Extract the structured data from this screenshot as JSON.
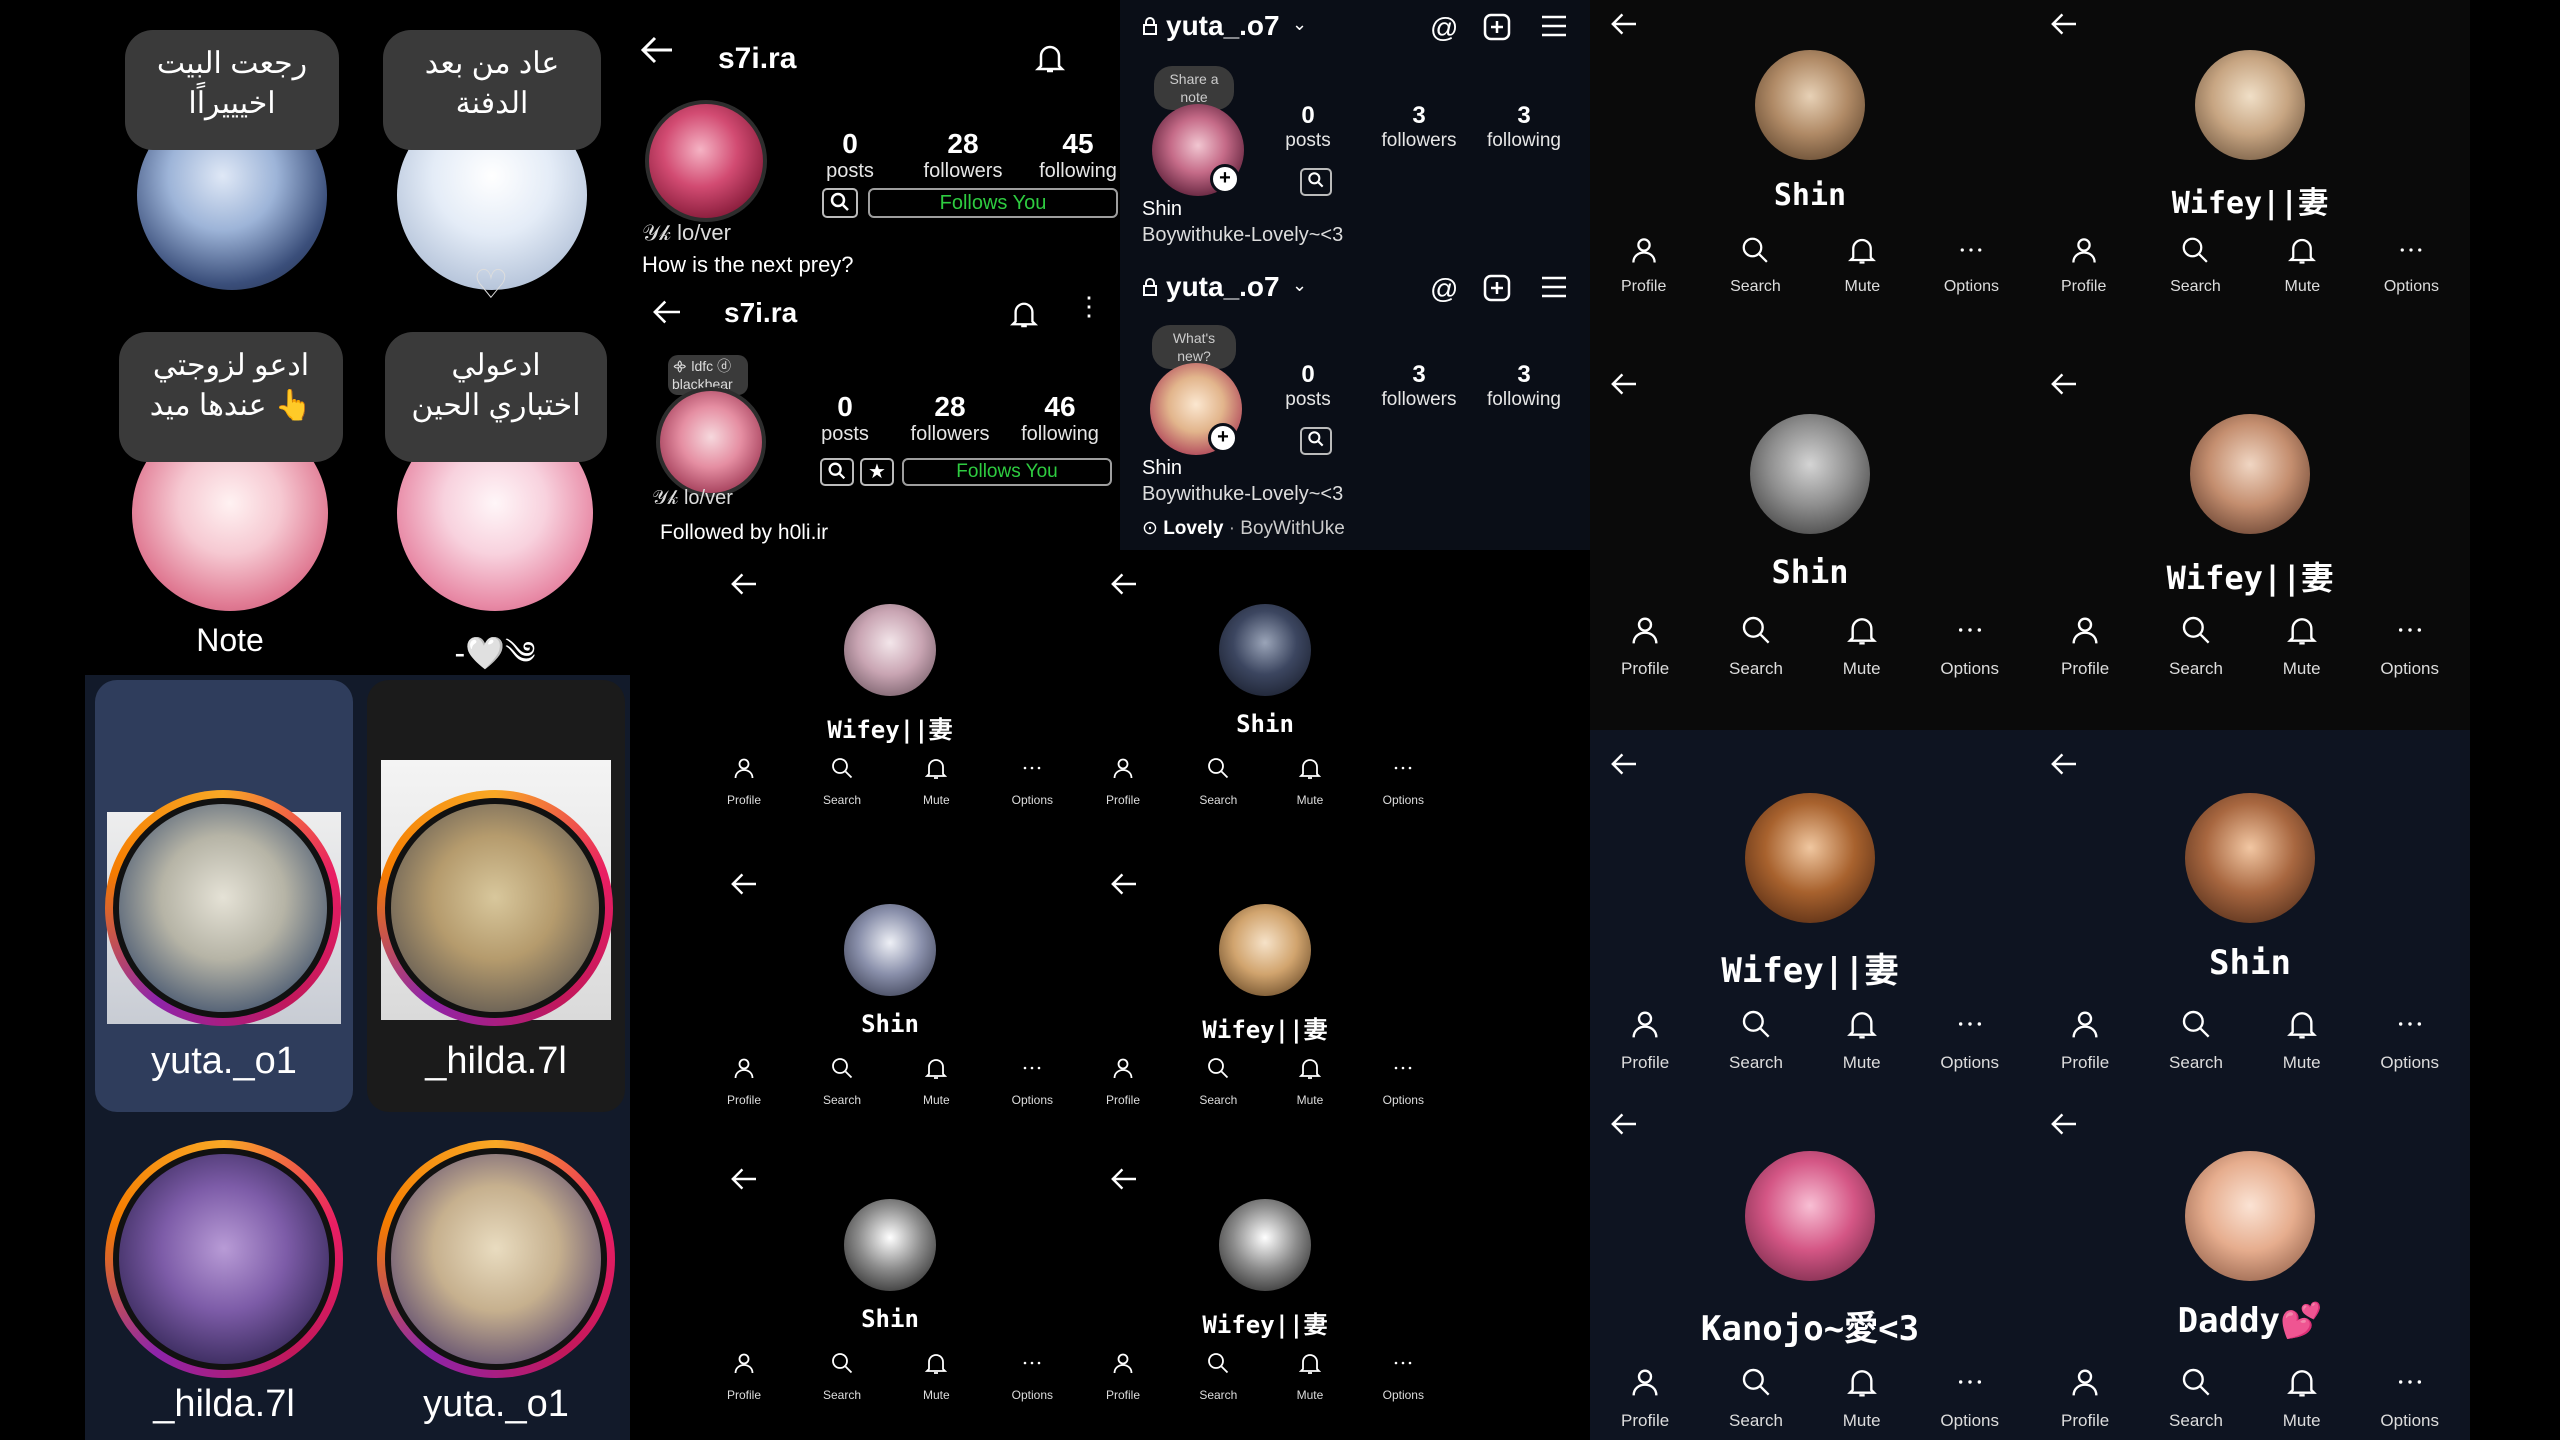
{
  "notes": [
    {
      "text": "رجعت البيت اخيييراًا",
      "label": ""
    },
    {
      "text": "عاد من بعد الدفنة",
      "label": ""
    },
    {
      "text": "ادعو لزوجتي 👆 عندها ميد",
      "label": "Note"
    },
    {
      "text": "ادعولي اختباري الحين",
      "label": "-🤍༄"
    }
  ],
  "story_tiles": [
    {
      "name": "yuta._o1"
    },
    {
      "name": "_hilda.7l"
    },
    {
      "name": "_hilda.7l"
    },
    {
      "name": "yuta._o1"
    }
  ],
  "profile_a": {
    "username": "s7i.ra",
    "posts": "0",
    "posts_label": "posts",
    "followers": "28",
    "followers_label": "followers",
    "following": "45",
    "following_label": "following",
    "display_name": "𝒴𝓀 lo/ver",
    "bio": "How is the next prey?",
    "follow_label": "Follows You"
  },
  "profile_b": {
    "username": "s7i.ra",
    "posts": "0",
    "posts_label": "posts",
    "followers": "28",
    "followers_label": "followers",
    "following": "46",
    "following_label": "following",
    "display_name": "𝒴𝓀 lo/ver",
    "story_note": "᯽ ldfc ⓓ blackbear",
    "followed_by": "Followed by h0li.ir",
    "follow_label": "Follows You"
  },
  "own_a": {
    "username": "yuta_.o7",
    "posts": "0",
    "posts_label": "posts",
    "followers": "3",
    "followers_label": "followers",
    "following": "3",
    "following_label": "following",
    "note_bubble": "Share a note",
    "name": "Shin",
    "bio": "Boywithuke-Lovely~<3"
  },
  "own_b": {
    "username": "yuta_.o7",
    "posts": "0",
    "posts_label": "posts",
    "followers": "3",
    "followers_label": "followers",
    "following": "3",
    "following_label": "following",
    "note_bubble": "What's new?",
    "name": "Shin",
    "bio": "Boywithuke-Lovely~<3",
    "music_title": "Lovely",
    "music_artist": "BoyWithUke"
  },
  "action_labels": {
    "profile": "Profile",
    "search": "Search",
    "mute": "Mute",
    "options": "Options"
  },
  "chat_cards": [
    {
      "name": "Shin"
    },
    {
      "name": "Wifey||妻"
    },
    {
      "name": "Shin"
    },
    {
      "name": "Wifey||妻"
    },
    {
      "name": "Wifey||妻"
    },
    {
      "name": "Shin"
    },
    {
      "name": "Kanojo~愛<3"
    },
    {
      "name": "Daddy💕"
    },
    {
      "name": "Wifey||妻"
    },
    {
      "name": "Shin"
    },
    {
      "name": "Shin"
    },
    {
      "name": "Wifey||妻"
    },
    {
      "name": "Shin"
    },
    {
      "name": "Wifey||妻"
    }
  ],
  "colors": {
    "follow_text": "#2ecc40",
    "story_ring_start": "#f9a825",
    "story_ring_end": "#8e24aa",
    "card_bg": "#0e1421"
  }
}
